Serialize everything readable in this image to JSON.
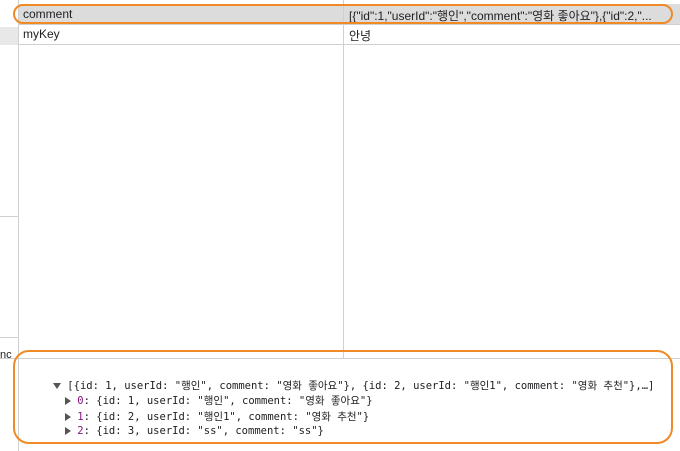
{
  "storage_table": {
    "rows": [
      {
        "key": "comment",
        "value": "[{\"id\":1,\"userId\":\"행인\",\"comment\":\"영화 좋아요\"},{\"id\":2,\"...",
        "selected": true
      },
      {
        "key": "myKey",
        "value": "안녕",
        "selected": false
      }
    ]
  },
  "left_panel": {
    "clipped_text": "nc"
  },
  "console": {
    "summary": "[{id: 1, userId: \"행인\", comment: \"영화 좋아요\"}, {id: 2, userId: \"행인1\", comment: \"영화 추천\"},…]",
    "items": [
      {
        "index": "0",
        "text": "{id: 1, userId: \"행인\", comment: \"영화 좋아요\"}"
      },
      {
        "index": "1",
        "text": "{id: 2, userId: \"행인1\", comment: \"영화 추천\"}"
      },
      {
        "index": "2",
        "text": "{id: 3, userId: \"ss\", comment: \"ss\"}"
      }
    ]
  },
  "colors": {
    "highlight": "#f08a24",
    "selected_row": "#dcdcdc",
    "index_key": "#881280"
  },
  "icons": {
    "expanded": "triangle-down-icon",
    "collapsed": "triangle-right-icon"
  }
}
